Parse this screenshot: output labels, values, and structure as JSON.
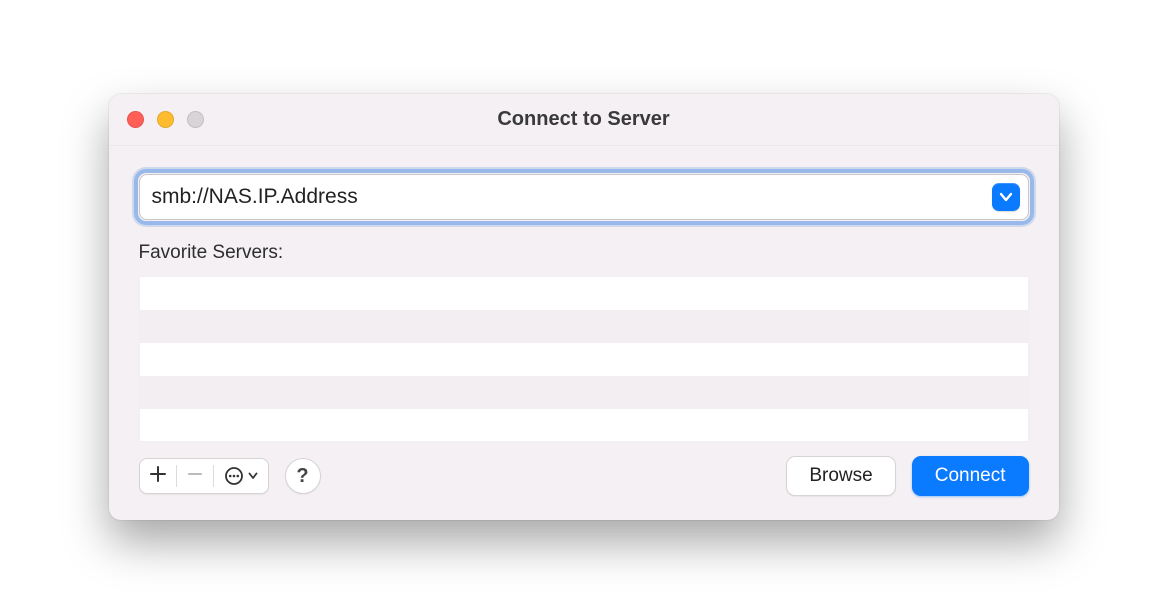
{
  "window": {
    "title": "Connect to Server"
  },
  "address": {
    "value": "smb://NAS.IP.Address"
  },
  "favorites": {
    "label": "Favorite Servers:"
  },
  "toolbar": {
    "add": "+",
    "remove": "−",
    "more": "⊙"
  },
  "help": {
    "label": "?"
  },
  "buttons": {
    "browse": "Browse",
    "connect": "Connect"
  }
}
